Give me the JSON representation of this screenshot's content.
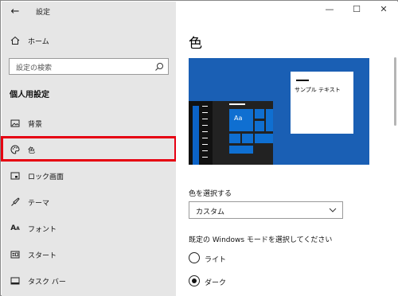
{
  "window": {
    "app_title": "設定",
    "controls": {
      "minimize": "—",
      "maximize": "☐",
      "close": "✕"
    }
  },
  "sidebar": {
    "home_label": "ホーム",
    "search_placeholder": "設定の検索",
    "section_title": "個人用設定",
    "items": [
      {
        "label": "背景",
        "icon": "picture-icon"
      },
      {
        "label": "色",
        "icon": "palette-icon",
        "selected": true
      },
      {
        "label": "ロック画面",
        "icon": "lock-screen-icon"
      },
      {
        "label": "テーマ",
        "icon": "theme-brush-icon"
      },
      {
        "label": "フォント",
        "icon": "font-icon"
      },
      {
        "label": "スタート",
        "icon": "start-icon"
      },
      {
        "label": "タスク バー",
        "icon": "taskbar-icon"
      }
    ]
  },
  "main": {
    "title": "色",
    "preview": {
      "tile_label": "Aa",
      "sample_text": "サンプル テキスト"
    },
    "choose_color_label": "色を選択する",
    "color_select_value": "カスタム",
    "mode_label": "既定の Windows モードを選択してください",
    "mode_options": [
      {
        "label": "ライト",
        "checked": false
      },
      {
        "label": "ダーク",
        "checked": true
      }
    ]
  },
  "colors": {
    "accent_blue": "#1a5fb4",
    "highlight_red": "#e60012",
    "sidebar_bg": "#e6e6e6"
  }
}
